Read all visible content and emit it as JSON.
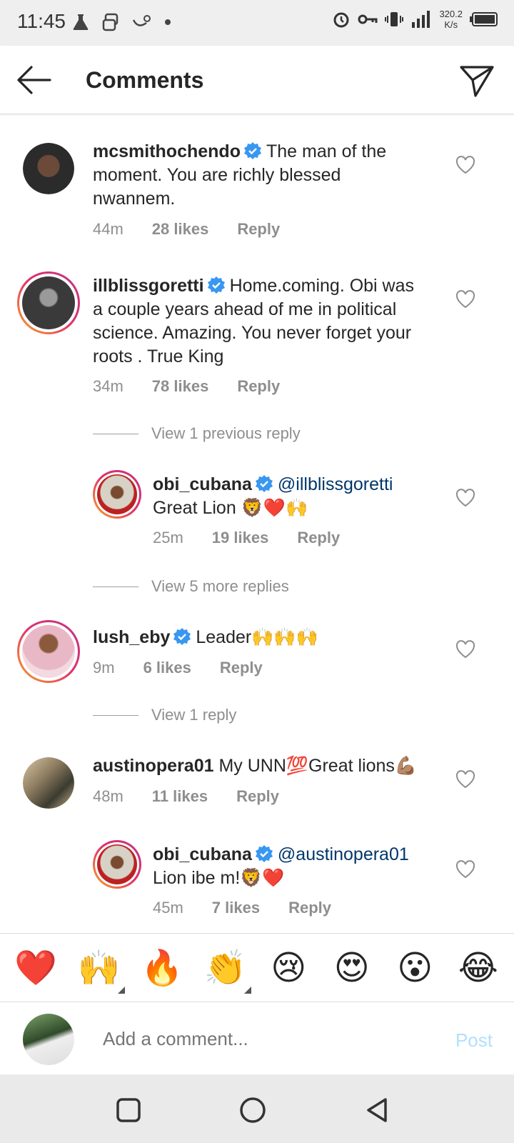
{
  "status_bar": {
    "time": "11:45",
    "speed_value": "320.2",
    "speed_unit": "K/s"
  },
  "header": {
    "title": "Comments"
  },
  "comments": [
    {
      "username": "mcsmithochendo",
      "text": "The man of the moment. You are richly blessed nwannem.",
      "time": "44m",
      "likes": "28 likes",
      "reply": "Reply"
    },
    {
      "username": "illblissgoretti",
      "text": "Home.coming. Obi was a couple years ahead of me in political science. Amazing. You never forget your roots . True King",
      "time": "34m",
      "likes": "78 likes",
      "reply": "Reply"
    },
    {
      "username": "obi_cubana",
      "mention": "@illblissgoretti",
      "text": "Great Lion 🦁❤️🙌",
      "time": "25m",
      "likes": "19 likes",
      "reply": "Reply"
    },
    {
      "username": "lush_eby",
      "text": "Leader🙌🙌🙌",
      "time": "9m",
      "likes": "6 likes",
      "reply": "Reply"
    },
    {
      "username": "austinopera01",
      "text": "My UNN💯Great lions💪🏽",
      "time": "48m",
      "likes": "11 likes",
      "reply": "Reply"
    },
    {
      "username": "obi_cubana",
      "mention": "@austinopera01",
      "text": "Lion ibe m!🦁❤️",
      "time": "45m",
      "likes": "7 likes",
      "reply": "Reply"
    }
  ],
  "view_replies": [
    {
      "label": "View 1 previous reply"
    },
    {
      "label": "View 5 more replies"
    },
    {
      "label": "View 1 reply"
    }
  ],
  "reactions": [
    "❤️",
    "🙌",
    "🔥",
    "👏",
    "😢",
    "😍",
    "😮",
    "😂"
  ],
  "add_comment": {
    "placeholder": "Add a comment...",
    "post_label": "Post"
  },
  "colors": {
    "accent_blue": "#0095f6",
    "post_disabled": "#b2dffc",
    "verified_blue": "#3897f0",
    "mention": "#00376b"
  }
}
